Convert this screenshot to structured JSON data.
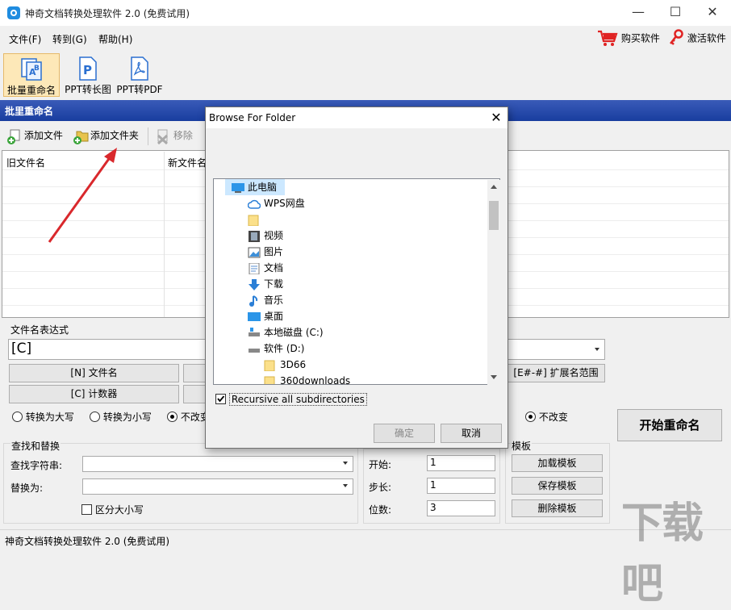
{
  "window": {
    "title": "神奇文档转换处理软件 2.0 (免费试用)",
    "minimize": "—",
    "maximize": "☐",
    "close": "✕"
  },
  "menu": {
    "items": [
      {
        "label": "文件(F)"
      },
      {
        "label": "转到(G)"
      },
      {
        "label": "帮助(H)"
      }
    ],
    "buy": "购买软件",
    "activate": "激活软件"
  },
  "toolbar": {
    "items": [
      {
        "label": "批量重命名"
      },
      {
        "label": "PPT转长图"
      },
      {
        "label": "PPT转PDF"
      }
    ]
  },
  "panel": {
    "title": "批里重命名",
    "add_file": "添加文件",
    "add_folder": "添加文件夹",
    "remove": "移除",
    "col_old": "旧文件名",
    "col_new": "新文件名"
  },
  "expr": {
    "label": "文件名表达式",
    "value": "[C]",
    "btn_filename": "[N] 文件名",
    "btn_counter": "[C] 计数器",
    "btn_ext_range": "[E#-#] 扩展名范围",
    "radio_upper": "转换为大写",
    "radio_lower": "转换为小写",
    "radio_nochange": "不改变",
    "radio_nochange2": "不改变"
  },
  "find": {
    "label": "查找和替换",
    "find_label": "查找字符串:",
    "replace_label": "替换为:",
    "case": "区分大小写"
  },
  "counter": {
    "start_label": "开始:",
    "start": "1",
    "step_label": "步长:",
    "step": "1",
    "digits_label": "位数:",
    "digits": "3"
  },
  "template": {
    "label": "模板",
    "load": "加载模板",
    "save": "保存模板",
    "delete": "删除模板"
  },
  "start_button": "开始重命名",
  "status": "神奇文档转换处理软件 2.0 (免费试用)",
  "dialog": {
    "title": "Browse For Folder",
    "close": "✕",
    "tree": [
      {
        "label": "此电脑",
        "icon": "computer-icon",
        "indent": 0
      },
      {
        "label": "WPS网盘",
        "icon": "cloud-icon",
        "indent": 1
      },
      {
        "label": "",
        "icon": "folder-icon",
        "indent": 1
      },
      {
        "label": "视频",
        "icon": "video-icon",
        "indent": 1
      },
      {
        "label": "图片",
        "icon": "picture-icon",
        "indent": 1
      },
      {
        "label": "文档",
        "icon": "document-icon",
        "indent": 1
      },
      {
        "label": "下载",
        "icon": "download-icon",
        "indent": 1
      },
      {
        "label": "音乐",
        "icon": "music-icon",
        "indent": 1
      },
      {
        "label": "桌面",
        "icon": "desktop-icon",
        "indent": 1
      },
      {
        "label": "本地磁盘 (C:)",
        "icon": "drive-icon",
        "indent": 1
      },
      {
        "label": "软件 (D:)",
        "icon": "drive-icon",
        "indent": 1
      },
      {
        "label": "3D66",
        "icon": "folder-icon",
        "indent": 2
      },
      {
        "label": "360downloads",
        "icon": "folder-icon",
        "indent": 2
      }
    ],
    "recursive": "Recursive all subdirectories",
    "ok": "确定",
    "cancel": "取消"
  },
  "watermark": "下载吧",
  "colors": {
    "panel_header": "#1f45a8",
    "selection": "#cce8ff",
    "arrow": "#d9282c"
  }
}
